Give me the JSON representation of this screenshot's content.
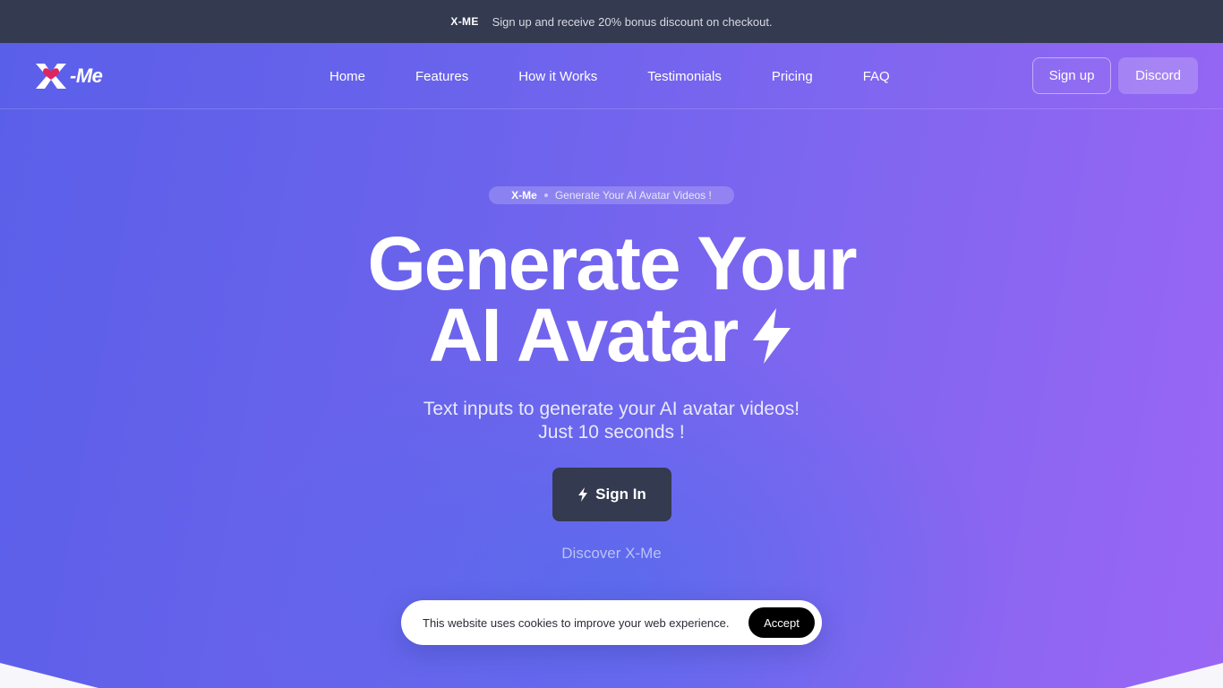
{
  "announcement": {
    "brand": "X-ME",
    "text": "Sign up and receive 20% bonus discount on checkout."
  },
  "header": {
    "logo_text": "-Me",
    "nav": [
      "Home",
      "Features",
      "How it Works",
      "Testimonials",
      "Pricing",
      "FAQ"
    ],
    "signup_label": "Sign up",
    "discord_label": "Discord"
  },
  "hero": {
    "pill_brand": "X-Me",
    "pill_text": "Generate Your AI Avatar Videos !",
    "headline_line1": "Generate Your",
    "headline_line2": "AI Avatar",
    "subtitle_line1": "Text inputs to generate your AI avatar videos!",
    "subtitle_line2": "Just 10 seconds !",
    "signin_label": "Sign In",
    "discover_label": "Discover X-Me"
  },
  "cookie": {
    "text": "This website uses cookies to improve your web experience.",
    "accept_label": "Accept"
  },
  "colors": {
    "announce_bg": "#343a4f",
    "hero_start": "#5a5fe9",
    "hero_end": "#9a66f4",
    "signin_bg": "#343a4f",
    "logo_heart": "#e0245e"
  },
  "icons": {
    "logo": "x-me-logo",
    "heart": "heart-icon",
    "headline_bolt": "lightning-bolt-icon",
    "button_bolt": "lightning-bolt-icon"
  }
}
